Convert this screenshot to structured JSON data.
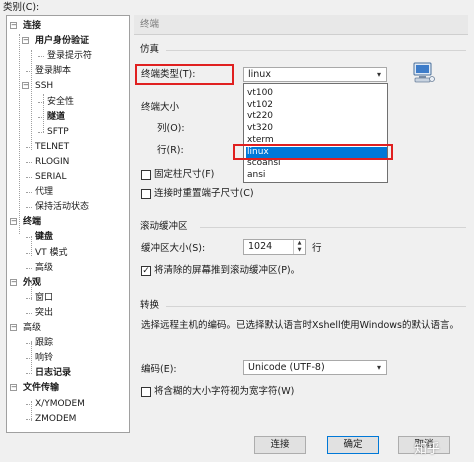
{
  "window": {
    "category_label": "类别(C):"
  },
  "tree": {
    "items": [
      {
        "label": "连接",
        "level": 0,
        "bold": true,
        "toggle": "−"
      },
      {
        "label": "用户身份验证",
        "level": 1,
        "bold": true,
        "toggle": "−"
      },
      {
        "label": "登录提示符",
        "level": 2,
        "bold": false
      },
      {
        "label": "登录脚本",
        "level": 1,
        "bold": false
      },
      {
        "label": "SSH",
        "level": 1,
        "bold": false,
        "toggle": "−"
      },
      {
        "label": "安全性",
        "level": 2,
        "bold": false
      },
      {
        "label": "隧道",
        "level": 2,
        "bold": true
      },
      {
        "label": "SFTP",
        "level": 2,
        "bold": false
      },
      {
        "label": "TELNET",
        "level": 1,
        "bold": false
      },
      {
        "label": "RLOGIN",
        "level": 1,
        "bold": false
      },
      {
        "label": "SERIAL",
        "level": 1,
        "bold": false
      },
      {
        "label": "代理",
        "level": 1,
        "bold": false
      },
      {
        "label": "保持活动状态",
        "level": 1,
        "bold": false
      },
      {
        "label": "终端",
        "level": 0,
        "bold": true,
        "toggle": "−"
      },
      {
        "label": "键盘",
        "level": 1,
        "bold": true
      },
      {
        "label": "VT 模式",
        "level": 1,
        "bold": false
      },
      {
        "label": "高级",
        "level": 1,
        "bold": false
      },
      {
        "label": "外观",
        "level": 0,
        "bold": true,
        "toggle": "−"
      },
      {
        "label": "窗口",
        "level": 1,
        "bold": false
      },
      {
        "label": "突出",
        "level": 1,
        "bold": false
      },
      {
        "label": "高级",
        "level": 0,
        "bold": false,
        "toggle": "−"
      },
      {
        "label": "跟踪",
        "level": 1,
        "bold": false
      },
      {
        "label": "响铃",
        "level": 1,
        "bold": false
      },
      {
        "label": "日志记录",
        "level": 1,
        "bold": true
      },
      {
        "label": "文件传输",
        "level": 0,
        "bold": true,
        "toggle": "−"
      },
      {
        "label": "X/YMODEM",
        "level": 1,
        "bold": false
      },
      {
        "label": "ZMODEM",
        "level": 1,
        "bold": false
      }
    ]
  },
  "panel": {
    "header": "终端",
    "emulation": {
      "section_title": "仿真",
      "terminal_type_label": "终端类型(T):",
      "terminal_type_value": "linux",
      "dropdown_options": [
        "vt100",
        "vt102",
        "vt220",
        "vt320",
        "xterm",
        "linux",
        "scoansi",
        "ansi"
      ],
      "dropdown_selected": "linux",
      "terminal_size_label": "终端大小",
      "columns_label": "列(O):",
      "rows_label": "行(R):",
      "fixed_size_label": "固定柱尺寸(F)",
      "fixed_size_checked": false,
      "reset_size_label": "连接时重置端子尺寸(C)",
      "reset_size_checked": false
    },
    "scrollback": {
      "section_title": "滚动缓冲区",
      "buffer_size_label": "缓冲区大小(S):",
      "buffer_size_value": "1024",
      "unit_label": "行",
      "push_cleared_label": "将清除的屏幕推到滚动缓冲区(P)。",
      "push_cleared_checked": true
    },
    "conversion": {
      "section_title": "转换",
      "description": "选择远程主机的编码。已选择默认语言时Xshell使用Windows的默认语言。",
      "encoding_label": "编码(E):",
      "encoding_value": "Unicode (UTF-8)",
      "ambiguous_label": "将含糊的大小字符视为宽字符(W)",
      "ambiguous_checked": false
    }
  },
  "footer": {
    "connect_label": "连接",
    "ok_label": "确定",
    "cancel_label": "取消"
  },
  "watermark": "知乎"
}
